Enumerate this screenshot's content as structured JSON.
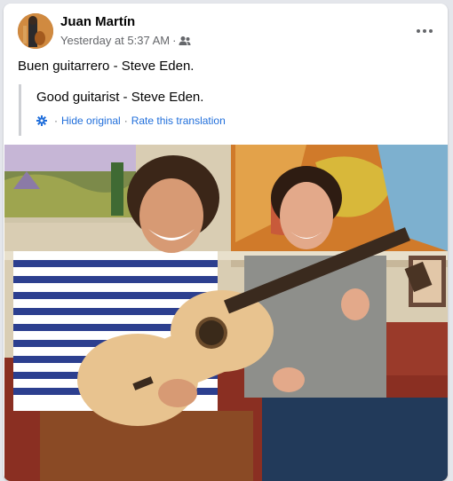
{
  "post": {
    "author_name": "Juan Martín",
    "timestamp": "Yesterday at 5:37 AM",
    "separator": "·",
    "audience_icon": "friends-icon",
    "more_icon": "more-horizontal-icon",
    "text": "Buen guitarrero - Steve Eden.",
    "translation": {
      "text": "Good guitarist - Steve Eden.",
      "settings_icon": "gear-icon",
      "hide_original_label": "Hide original",
      "rate_label": "Rate this translation"
    },
    "photo_icon": "photo"
  },
  "colors": {
    "link": "#216fdb",
    "secondary_text": "#65676b",
    "primary_text": "#050505",
    "card_bg": "#ffffff",
    "page_bg": "#e4e6eb"
  }
}
